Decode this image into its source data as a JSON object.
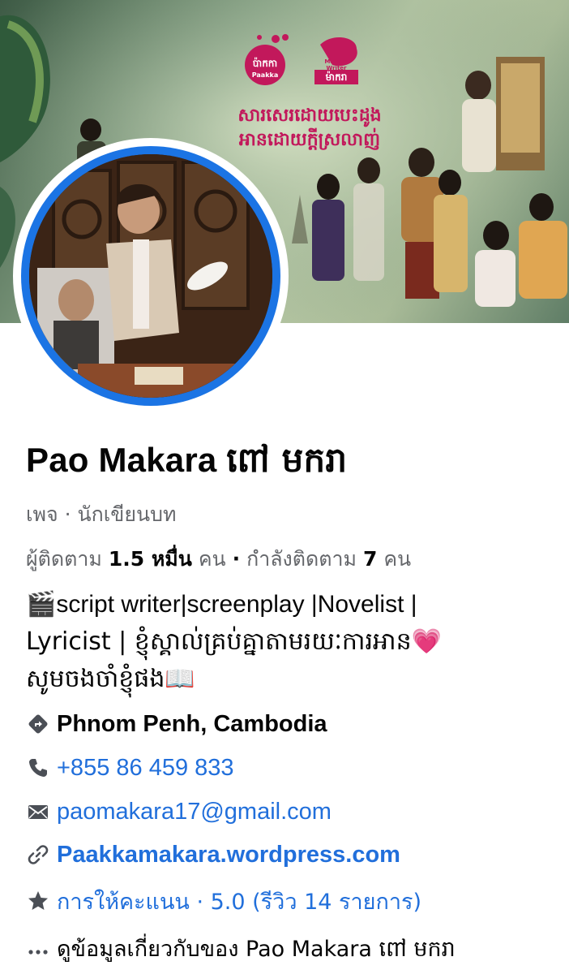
{
  "cover": {
    "title_line1": "សារសេរដោយបេះដូង",
    "title_line2": "អានដោយក្ដីស្រលាញ់",
    "brand_left": "ប៉ាកកា",
    "brand_left_sub": "Paakka",
    "brand_right": "ម៉ាករា",
    "brand_right_sub": "Makara Writer"
  },
  "profile": {
    "name_latin": "Pao Makara",
    "name_khmer": "ពៅ មករា",
    "category": "เพจ · นักเขียนบท",
    "followers_label": "ผู้ติดตาม",
    "followers_count": "1.5 หมื่น",
    "followers_unit": "คน",
    "separator": "·",
    "following_label": "กำลังติดตาม",
    "following_count": "7",
    "following_unit": "คน"
  },
  "bio": {
    "clapper_emoji": "🎬",
    "line1": "script writer|screenplay |Novelist |",
    "line2": "Lyricist | ខ្ញុំស្គាល់គ្រប់គ្នាតាមរយៈការអាន",
    "heart_emoji": "💗",
    "line3": "សូមចងចាំខ្ញុំផង",
    "book_emoji": "📖"
  },
  "details": {
    "location": "Phnom Penh, Cambodia",
    "phone": "+855 86 459 833",
    "email": "paomakara17@gmail.com",
    "website": "Paakkamakara.wordpress.com",
    "rating": "การให้คะแนน · 5.0 (รีวิว 14 รายการ)",
    "about": "ดูข้อมูลเกี่ยวกับของ Pao Makara ពៅ មករា"
  },
  "icons": {
    "location": "directions-icon",
    "phone": "phone-icon",
    "email": "mail-icon",
    "website": "link-icon",
    "rating": "star-icon",
    "about": "more-icon"
  },
  "colors": {
    "link_blue": "#216fdb",
    "avatar_ring": "#1b74e4",
    "secondary_text": "#65676b"
  }
}
